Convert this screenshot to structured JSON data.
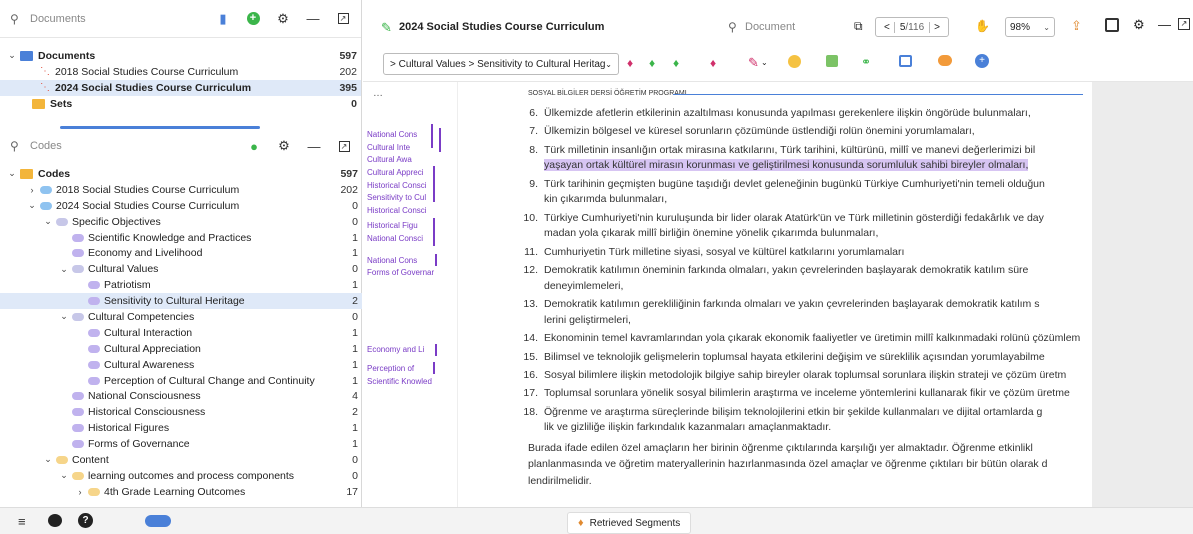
{
  "documents_panel": {
    "search_placeholder": "Documents",
    "rows": [
      {
        "label": "Documents",
        "count": "597"
      },
      {
        "label": "2018 Social Studies Course Curriculum",
        "count": "202"
      },
      {
        "label": "2024 Social Studies Course Curriculum",
        "count": "395"
      },
      {
        "label": "Sets",
        "count": "0"
      }
    ]
  },
  "codes_panel": {
    "search_placeholder": "Codes",
    "rows": [
      {
        "label": "Codes",
        "count": "597"
      },
      {
        "label": "2018 Social Studies Course Curriculum",
        "count": "202"
      },
      {
        "label": "2024 Social Studies Course Curriculum",
        "count": "0"
      },
      {
        "label": "Specific Objectives",
        "count": "0"
      },
      {
        "label": "Scientific Knowledge and Practices",
        "count": "1"
      },
      {
        "label": "Economy and  Livelihood",
        "count": "1"
      },
      {
        "label": "Cultural Values",
        "count": "0"
      },
      {
        "label": "Patriotism",
        "count": "1"
      },
      {
        "label": "Sensitivity to Cultural Heritage",
        "count": "2"
      },
      {
        "label": "Cultural Competencies",
        "count": "0"
      },
      {
        "label": "Cultural Interaction",
        "count": "1"
      },
      {
        "label": "Cultural Appreciation",
        "count": "1"
      },
      {
        "label": "Cultural Awareness",
        "count": "1"
      },
      {
        "label": "Perception of Cultural Change and Continuity",
        "count": "1"
      },
      {
        "label": "National Consciousness",
        "count": "4"
      },
      {
        "label": "Historical Consciousness",
        "count": "2"
      },
      {
        "label": "Historical Figures",
        "count": "1"
      },
      {
        "label": "Forms of Governance",
        "count": "1"
      },
      {
        "label": "Content",
        "count": "0"
      },
      {
        "label": "learning outcomes and process components",
        "count": "0"
      },
      {
        "label": "4th Grade Learning Outcomes",
        "count": "17"
      }
    ]
  },
  "document": {
    "title": "2024 Social Studies Course Curriculum",
    "search_placeholder": "Document",
    "page_current": "5",
    "page_total": "/116",
    "zoom": "98%",
    "breadcrumb": "> Cultural Values > Sensitivity to Cultural Heritage",
    "section_header": "SOSYAL BİLGİLER DERSİ ÖĞRETİM PROGRAMI",
    "paragraphs": [
      {
        "num": "6.",
        "lines": [
          "Ülkemizde afetlerin etkilerinin azaltılması konusunda yapılması gerekenlere ilişkin öngörüde bulunmaları,"
        ]
      },
      {
        "num": "7.",
        "lines": [
          "Ülkemizin bölgesel ve küresel sorunların çözümünde üstlendiği rolün önemini yorumlamaları,"
        ]
      },
      {
        "num": "8.",
        "lines": [
          "Türk milletinin insanlığın ortak mirasına katkılarını, Türk tarihini, kültürünü, millî ve manevi değerlerimizi bil",
          "yaşayan ortak kültürel mirasın korunması ve geliştirilmesi konusunda sorumluluk sahibi bireyler olmaları,"
        ]
      },
      {
        "num": "9.",
        "lines": [
          "Türk tarihinin geçmişten bugüne taşıdığı devlet geleneğinin bugünkü Türkiye Cumhuriyeti'nin temeli olduğun",
          "kin çıkarımda bulunmaları,"
        ]
      },
      {
        "num": "10.",
        "lines": [
          "Türkiye Cumhuriyeti'nin kuruluşunda bir lider olarak Atatürk'ün ve Türk milletinin gösterdiği fedakârlık ve day",
          "madan yola çıkarak millî birliğin önemine yönelik çıkarımda bulunmaları,"
        ]
      },
      {
        "num": "11.",
        "lines": [
          "Cumhuriyetin Türk milletine siyasi, sosyal ve kültürel katkılarını yorumlamaları"
        ]
      },
      {
        "num": "12.",
        "lines": [
          "Demokratik katılımın öneminin farkında olmaları, yakın çevrelerinden başlayarak demokratik katılım süre",
          "deneyimlemeleri,"
        ]
      },
      {
        "num": "13.",
        "lines": [
          "Demokratik katılımın gerekliliğinin farkında olmaları ve yakın çevrelerinden başlayarak demokratik katılım s",
          "lerini geliştirmeleri,"
        ]
      },
      {
        "num": "14.",
        "lines": [
          "Ekonominin temel kavramlarından yola çıkarak ekonomik faaliyetler ve üretimin millî kalkınmadaki rolünü çözümlem"
        ]
      },
      {
        "num": "15.",
        "lines": [
          "Bilimsel ve teknolojik gelişmelerin toplumsal hayata etkilerini değişim ve süreklilik açısından yorumlayabilme"
        ]
      },
      {
        "num": "16.",
        "lines": [
          "Sosyal bilimlere ilişkin metodolojik bilgiye sahip bireyler olarak toplumsal sorunlara ilişkin strateji ve çözüm üretm"
        ]
      },
      {
        "num": "17.",
        "lines": [
          "Toplumsal sorunlara yönelik sosyal bilimlerin araştırma ve inceleme yöntemlerini kullanarak fikir ve çözüm üretme"
        ]
      },
      {
        "num": "18.",
        "lines": [
          "Öğrenme ve araştırma süreçlerinde bilişim teknolojilerini etkin bir şekilde kullanmaları ve dijital ortamlarda g",
          "lik ve gizliliğe ilişkin farkındalık kazanmaları amaçlanmaktadır."
        ]
      }
    ],
    "closing": [
      "Burada ifade edilen özel amaçların her birinin öğrenme çıktılarında karşılığı yer almaktadır. Öğrenme etkinlikl",
      "planlanmasında ve öğretim materyallerinin hazırlanmasında özel amaçlar ve öğrenme çıktıları bir bütün olarak d",
      "lendirilmelidir."
    ]
  },
  "code_strip": [
    "National Cons",
    "Cultural Inte",
    "Cultural Awa",
    "Cultural Appreci",
    "Historical Consci",
    "Sensitivity to Cul",
    "Historical Consci",
    "Historical Figu",
    "National Consci",
    "National Cons",
    "Forms of Governar",
    "Economy and  Li",
    "Perception of",
    "Scientific Knowled"
  ],
  "bottom": {
    "retrieved_label": "Retrieved Segments"
  },
  "colors": {
    "highlight": "#d7c5f3",
    "accent": "#4a80d8",
    "code_purple": "#7a3cc6",
    "folder_orange": "#f3b53a"
  }
}
